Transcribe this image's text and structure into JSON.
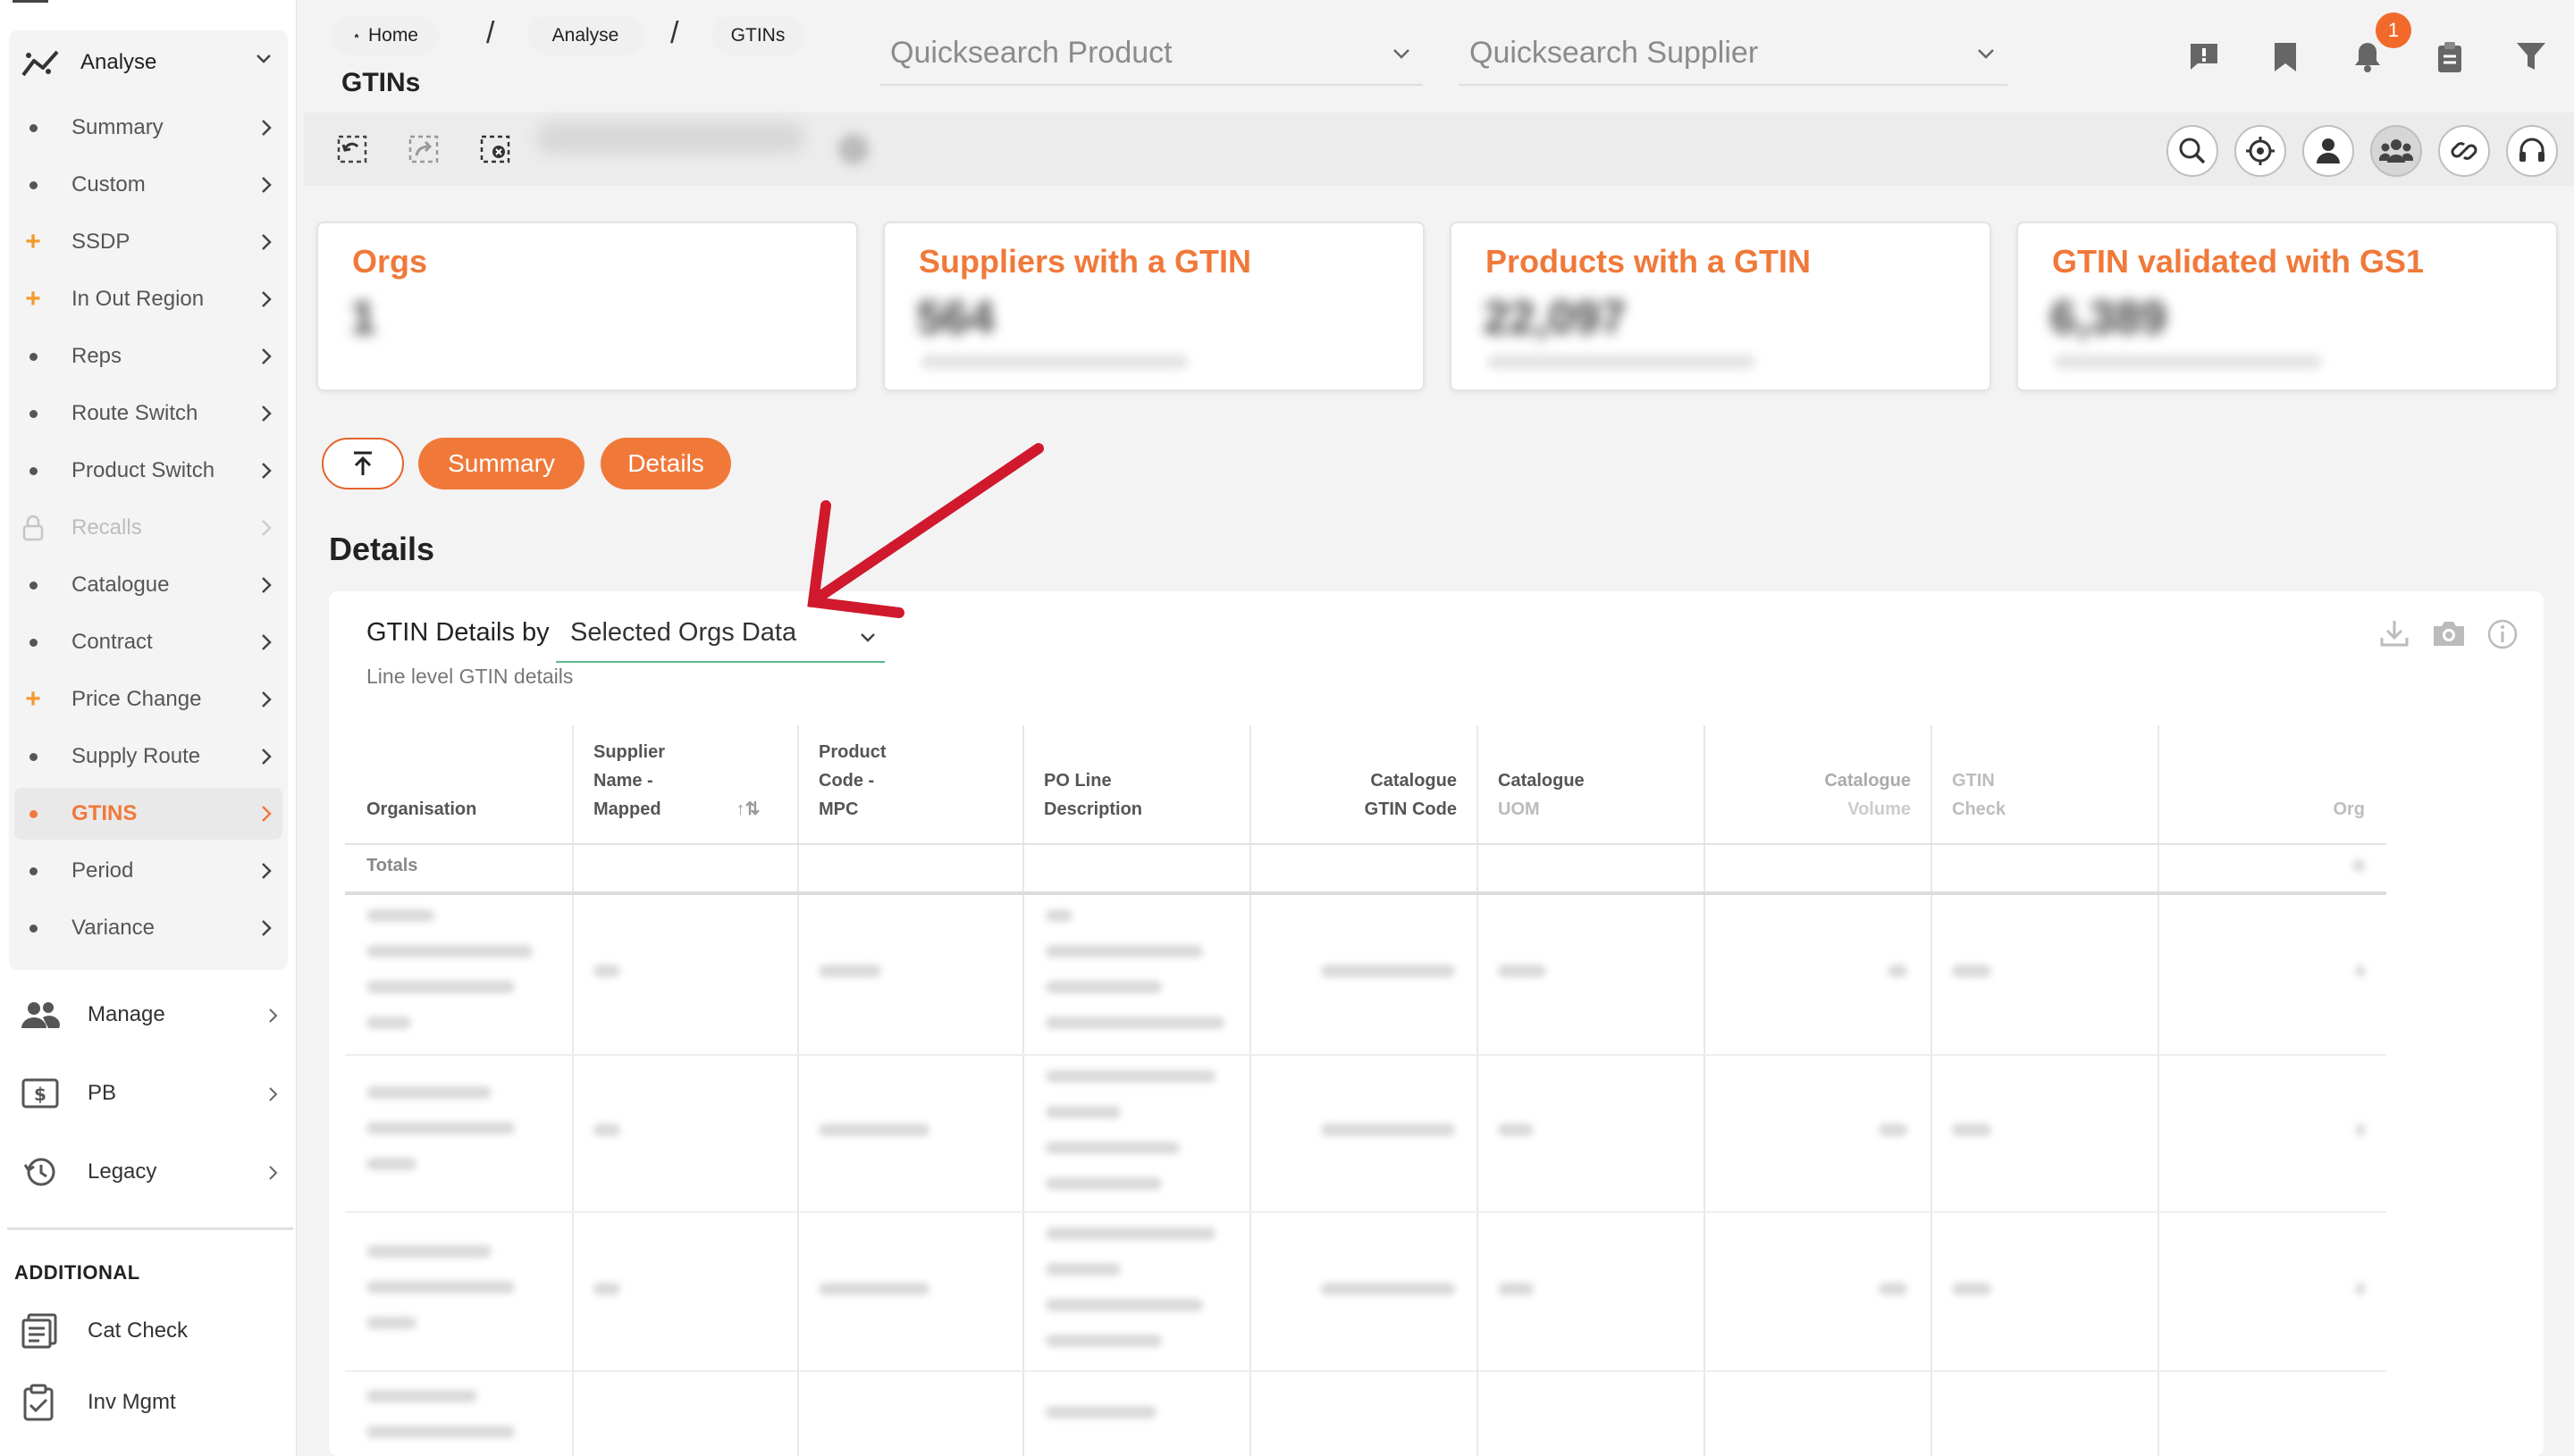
{
  "sidebar": {
    "analyse_label": "Analyse",
    "items": [
      {
        "label": "Summary",
        "bullet": "dot"
      },
      {
        "label": "Custom",
        "bullet": "dot"
      },
      {
        "label": "SSDP",
        "bullet": "plus"
      },
      {
        "label": "In Out Region",
        "bullet": "plus"
      },
      {
        "label": "Reps",
        "bullet": "dot"
      },
      {
        "label": "Route Switch",
        "bullet": "dot"
      },
      {
        "label": "Product Switch",
        "bullet": "dot"
      },
      {
        "label": "Recalls",
        "bullet": "lock",
        "disabled": true
      },
      {
        "label": "Catalogue",
        "bullet": "dot"
      },
      {
        "label": "Contract",
        "bullet": "dot"
      },
      {
        "label": "Price Change",
        "bullet": "plus"
      },
      {
        "label": "Supply Route",
        "bullet": "dot"
      },
      {
        "label": "GTINS",
        "bullet": "dot",
        "active": true
      },
      {
        "label": "Period",
        "bullet": "dot"
      },
      {
        "label": "Variance",
        "bullet": "dot"
      }
    ],
    "main_items": [
      {
        "label": "Manage",
        "icon": "users-icon"
      },
      {
        "label": "PB",
        "icon": "dollar-icon"
      },
      {
        "label": "Legacy",
        "icon": "history-icon"
      }
    ],
    "additional_title": "ADDITIONAL",
    "additional_items": [
      {
        "label": "Cat Check",
        "icon": "list-check-icon"
      },
      {
        "label": "Inv Mgmt",
        "icon": "clipboard-check-icon"
      }
    ]
  },
  "header": {
    "breadcrumb": [
      "Home",
      "Analyse",
      "GTINs"
    ],
    "page_title": "GTINs",
    "quicksearch_product": "Quicksearch Product",
    "quicksearch_supplier": "Quicksearch Supplier",
    "notification_count": "1"
  },
  "kpis": [
    {
      "title": "Orgs",
      "value": "1"
    },
    {
      "title": "Suppliers with a GTIN",
      "value": "564"
    },
    {
      "title": "Products with a GTIN",
      "value": "22,097"
    },
    {
      "title": "GTIN validated with GS1",
      "value": "6,389"
    }
  ],
  "tabs": {
    "summary": "Summary",
    "details": "Details"
  },
  "details": {
    "heading": "Details",
    "by_label": "GTIN Details by",
    "selected_option": "Selected Orgs Data",
    "subtitle": "Line level GTIN details"
  },
  "table": {
    "columns": [
      {
        "line1": "",
        "line2": "",
        "line3": "Organisation"
      },
      {
        "line1": "Supplier",
        "line2": "Name -",
        "line3": "Mapped"
      },
      {
        "line1": "Product",
        "line2": "Code -",
        "line3": "MPC"
      },
      {
        "line1": "",
        "line2": "PO Line",
        "line3": "Description"
      },
      {
        "line1": "",
        "line2": "Catalogue",
        "line3": "GTIN Code"
      },
      {
        "line1": "",
        "line2": "Catalogue",
        "line3": "UOM"
      },
      {
        "line1": "",
        "line2": "Catalogue",
        "line3": "Volume"
      },
      {
        "line1": "",
        "line2": "GTIN",
        "line3": "Check"
      },
      {
        "line1": "",
        "line2": "",
        "line3": "Org"
      }
    ],
    "sort_indicator": "↑⇅",
    "totals_label": "Totals"
  },
  "colors": {
    "accent": "#f0793a",
    "arrow": "#d0192d",
    "select_underline": "#5bb98f"
  }
}
